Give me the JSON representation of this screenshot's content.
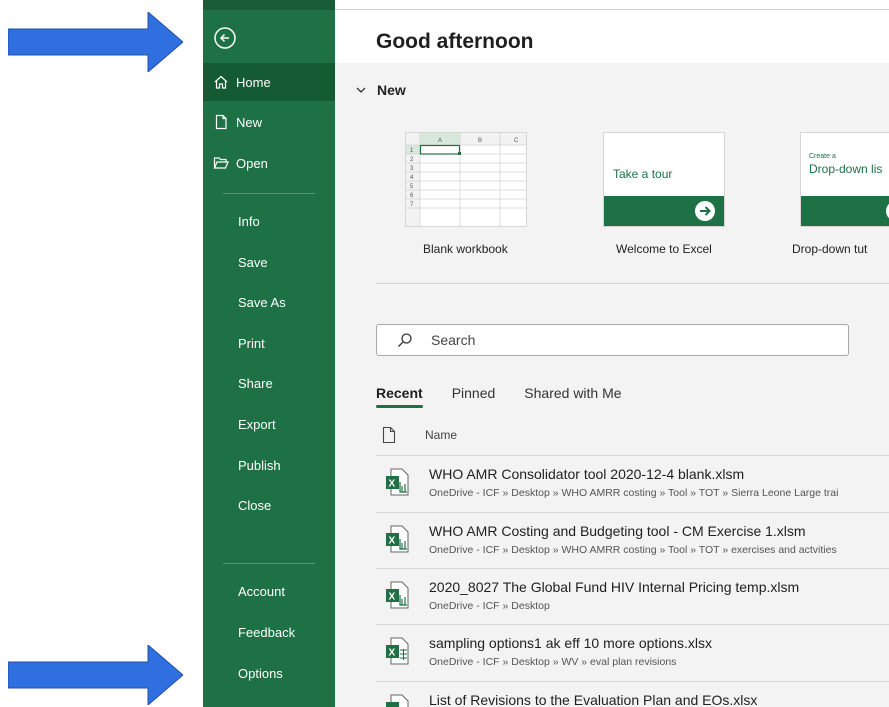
{
  "colors": {
    "brand_green": "#1e7145",
    "active_green": "#145a32",
    "arrow_blue": "#2f6fe0"
  },
  "sidebar": {
    "back_icon": "back-arrow-circle-icon",
    "items": [
      {
        "label": "Home",
        "icon": "home-icon"
      },
      {
        "label": "New",
        "icon": "new-document-icon"
      },
      {
        "label": "Open",
        "icon": "folder-open-icon"
      },
      {
        "label": "Info"
      },
      {
        "label": "Save"
      },
      {
        "label": "Save As"
      },
      {
        "label": "Print"
      },
      {
        "label": "Share"
      },
      {
        "label": "Export"
      },
      {
        "label": "Publish"
      },
      {
        "label": "Close"
      },
      {
        "label": "Account"
      },
      {
        "label": "Feedback"
      },
      {
        "label": "Options"
      }
    ]
  },
  "main": {
    "greeting": "Good afternoon",
    "new_section": "New",
    "templates": [
      {
        "label": "Blank workbook",
        "cols": [
          "A",
          "B",
          "C"
        ],
        "rows": [
          "1",
          "2",
          "3",
          "4",
          "5",
          "6",
          "7"
        ]
      },
      {
        "label": "Welcome to Excel",
        "thumb_text": "Take a tour"
      },
      {
        "label": "Drop-down tut",
        "thumb_small": "Create a",
        "thumb_text": "Drop-down lis"
      }
    ],
    "search_placeholder": "Search",
    "tabs": [
      "Recent",
      "Pinned",
      "Shared with Me"
    ],
    "column_name": "Name",
    "files": [
      {
        "name": "WHO AMR Consolidator tool 2020-12-4 blank.xlsm",
        "path": "OneDrive - ICF » Desktop » WHO AMRR costing » Tool » TOT » Sierra Leone Large trai"
      },
      {
        "name": "WHO AMR Costing and Budgeting  tool - CM Exercise 1.xlsm",
        "path": "OneDrive - ICF » Desktop » WHO AMRR costing » Tool » TOT » exercises and actvities"
      },
      {
        "name": "2020_8027 The Global Fund HIV Internal Pricing temp.xlsm",
        "path": "OneDrive - ICF » Desktop"
      },
      {
        "name": "sampling options1 ak eff 10 more options.xlsx",
        "path": "OneDrive - ICF » Desktop » WV » eval plan revisions"
      },
      {
        "name": "List of Revisions to the Evaluation Plan and EOs.xlsx",
        "path": ""
      }
    ]
  }
}
